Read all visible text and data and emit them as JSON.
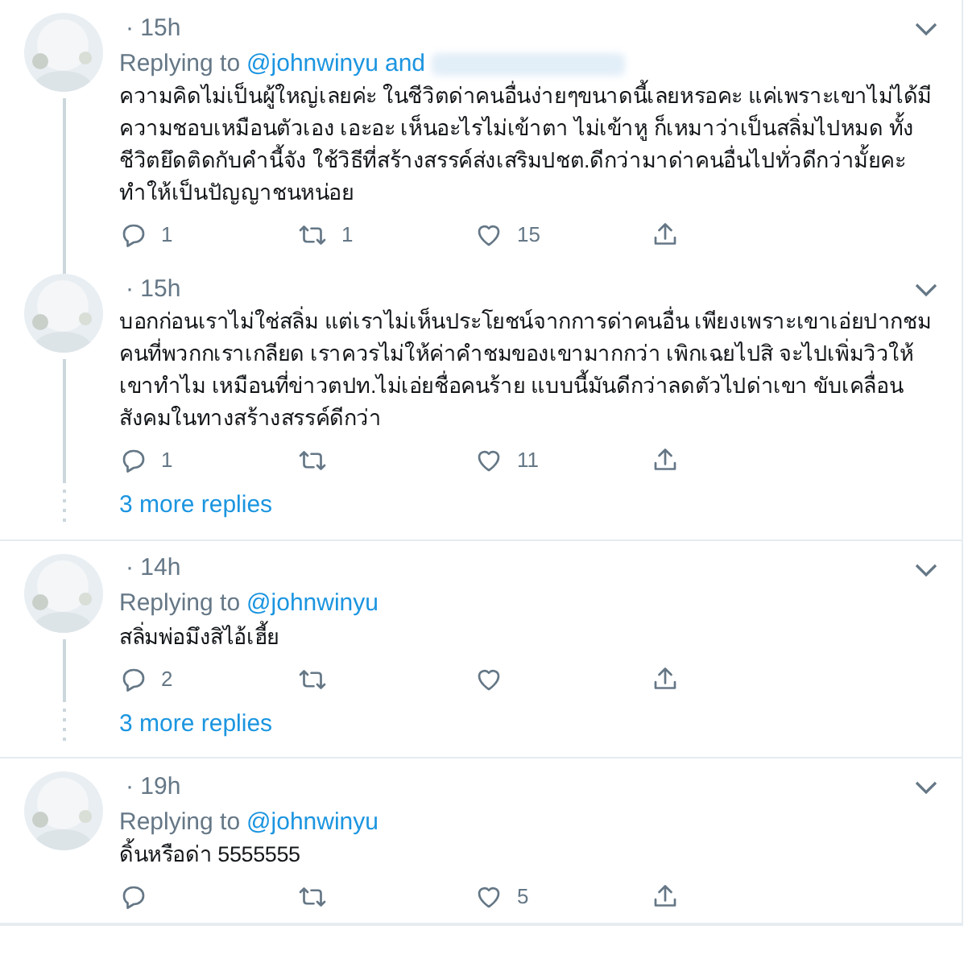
{
  "tweets": [
    {
      "time": "· 15h",
      "replying_label": "Replying to",
      "mentions": [
        "@johnwinyu"
      ],
      "joiner": "and",
      "extra_mention_redacted": true,
      "text": "ความคิดไม่เป็นผู้ใหญ่เลยค่ะ ในชีวิตด่าคนอื่นง่ายๆขนาดนี้เลยหรอคะ แค่เพราะเขาไม่ได้มีความชอบเหมือนตัวเอง เอะอะ เห็นอะไรไม่เข้าตา ไม่เข้าหู ก็เหมาว่าเป็นสลิ่มไปหมด ทั้งชีวิตยึดติดกับคำนี้จัง ใช้วิธีที่สร้างสรรค์ส่งเสริมปชต.ดีกว่ามาด่าคนอื่นไปทั่วดีกว่ามั้ยคะ ทำให้เป็นปัญญาชนหน่อย",
      "replies": "1",
      "retweets": "1",
      "likes": "15",
      "connects_next": true
    },
    {
      "time": "· 15h",
      "text": "บอกก่อนเราไม่ใช่สลิ่ม แต่เราไม่เห็นประโยชน์จากการด่าคนอื่น เพียงเพราะเขาเอ่ยปากชมคนที่พวกกเราเกลียด เราควรไม่ให้ค่าคำชมของเขามากกว่า เพิกเฉยไปสิ จะไปเพิ่มวิวให้เขาทำไม เหมือนที่ข่าวตปท.ไม่เอ่ยชื่อคนร้าย แบบนี้มันดีกว่าลดตัวไปด่าเขา ขับเคลื่อนสังคมในทางสร้างสรรค์ดีกว่า",
      "replies": "1",
      "likes": "11",
      "more_replies": "3 more replies"
    },
    {
      "time": "· 14h",
      "replying_label": "Replying to",
      "mentions": [
        "@johnwinyu"
      ],
      "text": "สลิ่มพ่อมึงสิไอ้เฮี้ย",
      "replies": "2",
      "more_replies": "3 more replies"
    },
    {
      "time": "· 19h",
      "replying_label": "Replying to",
      "mentions": [
        "@johnwinyu"
      ],
      "text": "ดิ้นหรือด่า 5555555",
      "likes": "5"
    }
  ]
}
